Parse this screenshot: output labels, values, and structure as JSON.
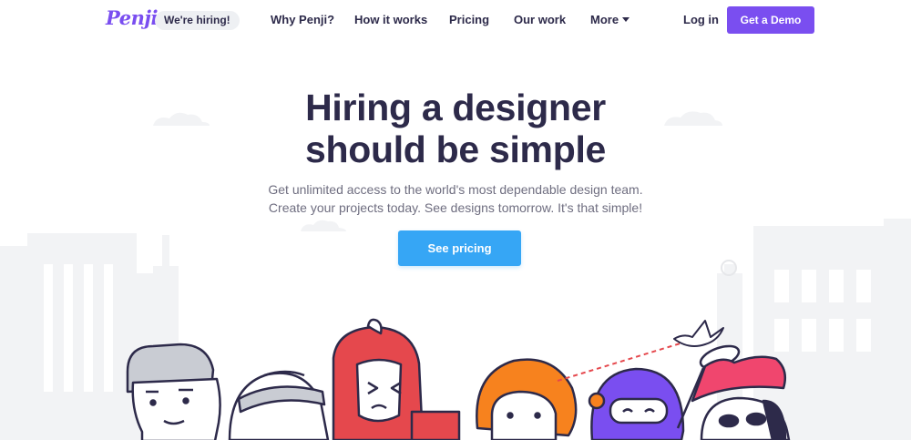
{
  "brand": {
    "logo_text": "Penji",
    "accent": "#7a4ef0",
    "cta_color": "#36a6f5",
    "text_dark": "#2d2a4a"
  },
  "nav": {
    "hiring_badge": "We're hiring!",
    "links": [
      "Why Penji?",
      "How it works",
      "Pricing",
      "Our work",
      "More"
    ],
    "login": "Log in",
    "demo": "Get a Demo"
  },
  "hero": {
    "title_line1": "Hiring a designer",
    "title_line2": "should be simple",
    "subtitle_line1": "Get unlimited access to the world's most dependable design team.",
    "subtitle_line2": "Create your projects today. See designs tomorrow. It's that simple!",
    "cta": "See pricing"
  },
  "illustration": {
    "characters": [
      "glasses-man",
      "headband-person",
      "red-hooded-warrior",
      "orange-haired-girl",
      "purple-ninja",
      "pink-hat-bandit"
    ],
    "props": [
      "bird",
      "butterfly-net",
      "laser-beam"
    ]
  }
}
